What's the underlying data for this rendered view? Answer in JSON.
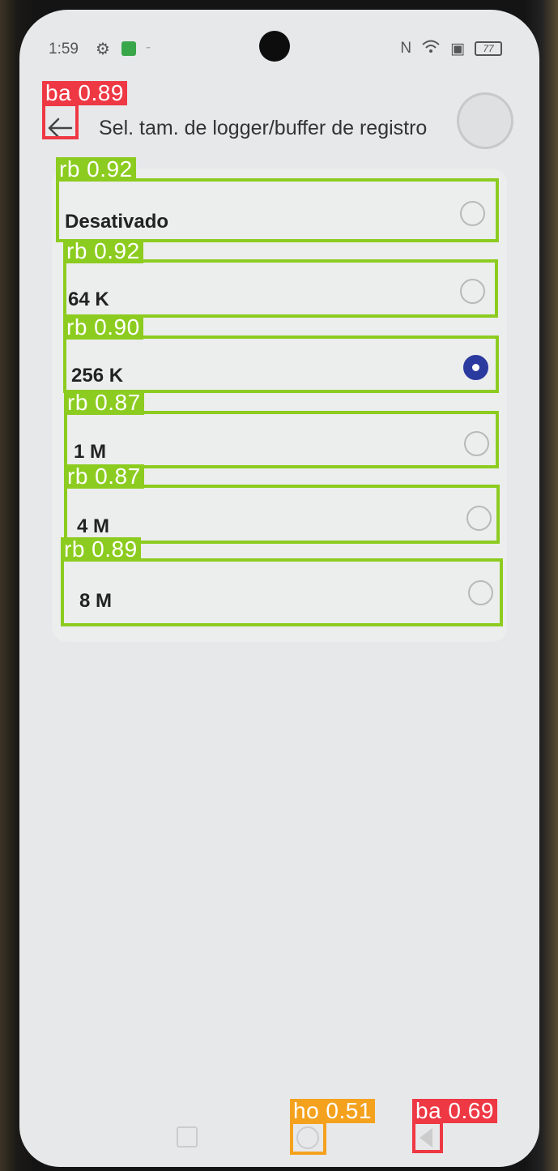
{
  "status_bar": {
    "time": "1:59",
    "battery": "77",
    "icons": [
      "sync-icon",
      "app-notification-icon",
      "nfc-icon",
      "wifi-icon",
      "sim-icon"
    ]
  },
  "app_bar": {
    "title": "Sel. tam. de logger/buffer de registro",
    "back_icon": "arrow-left-icon"
  },
  "options": [
    {
      "label": "Desativado",
      "checked": false
    },
    {
      "label": "64 K",
      "checked": false
    },
    {
      "label": "256 K",
      "checked": true
    },
    {
      "label": "1 M",
      "checked": false
    },
    {
      "label": "4 M",
      "checked": false
    },
    {
      "label": "8 M",
      "checked": false
    }
  ],
  "detections": [
    {
      "label": "ba 0.89",
      "color": "#ee3844"
    },
    {
      "label": "rb 0.92",
      "color": "#8ccc20"
    },
    {
      "label": "rb 0.92",
      "color": "#8ccc20"
    },
    {
      "label": "rb 0.90",
      "color": "#8ccc20"
    },
    {
      "label": "rb 0.87",
      "color": "#8ccc20"
    },
    {
      "label": "rb 0.87",
      "color": "#8ccc20"
    },
    {
      "label": "rb 0.89",
      "color": "#8ccc20"
    },
    {
      "label": "ho 0.51",
      "color": "#f4a21e"
    },
    {
      "label": "ba 0.69",
      "color": "#ee3844"
    }
  ],
  "colors": {
    "accent": "#2b3a9f",
    "screen_bg": "#e7e8ea"
  }
}
